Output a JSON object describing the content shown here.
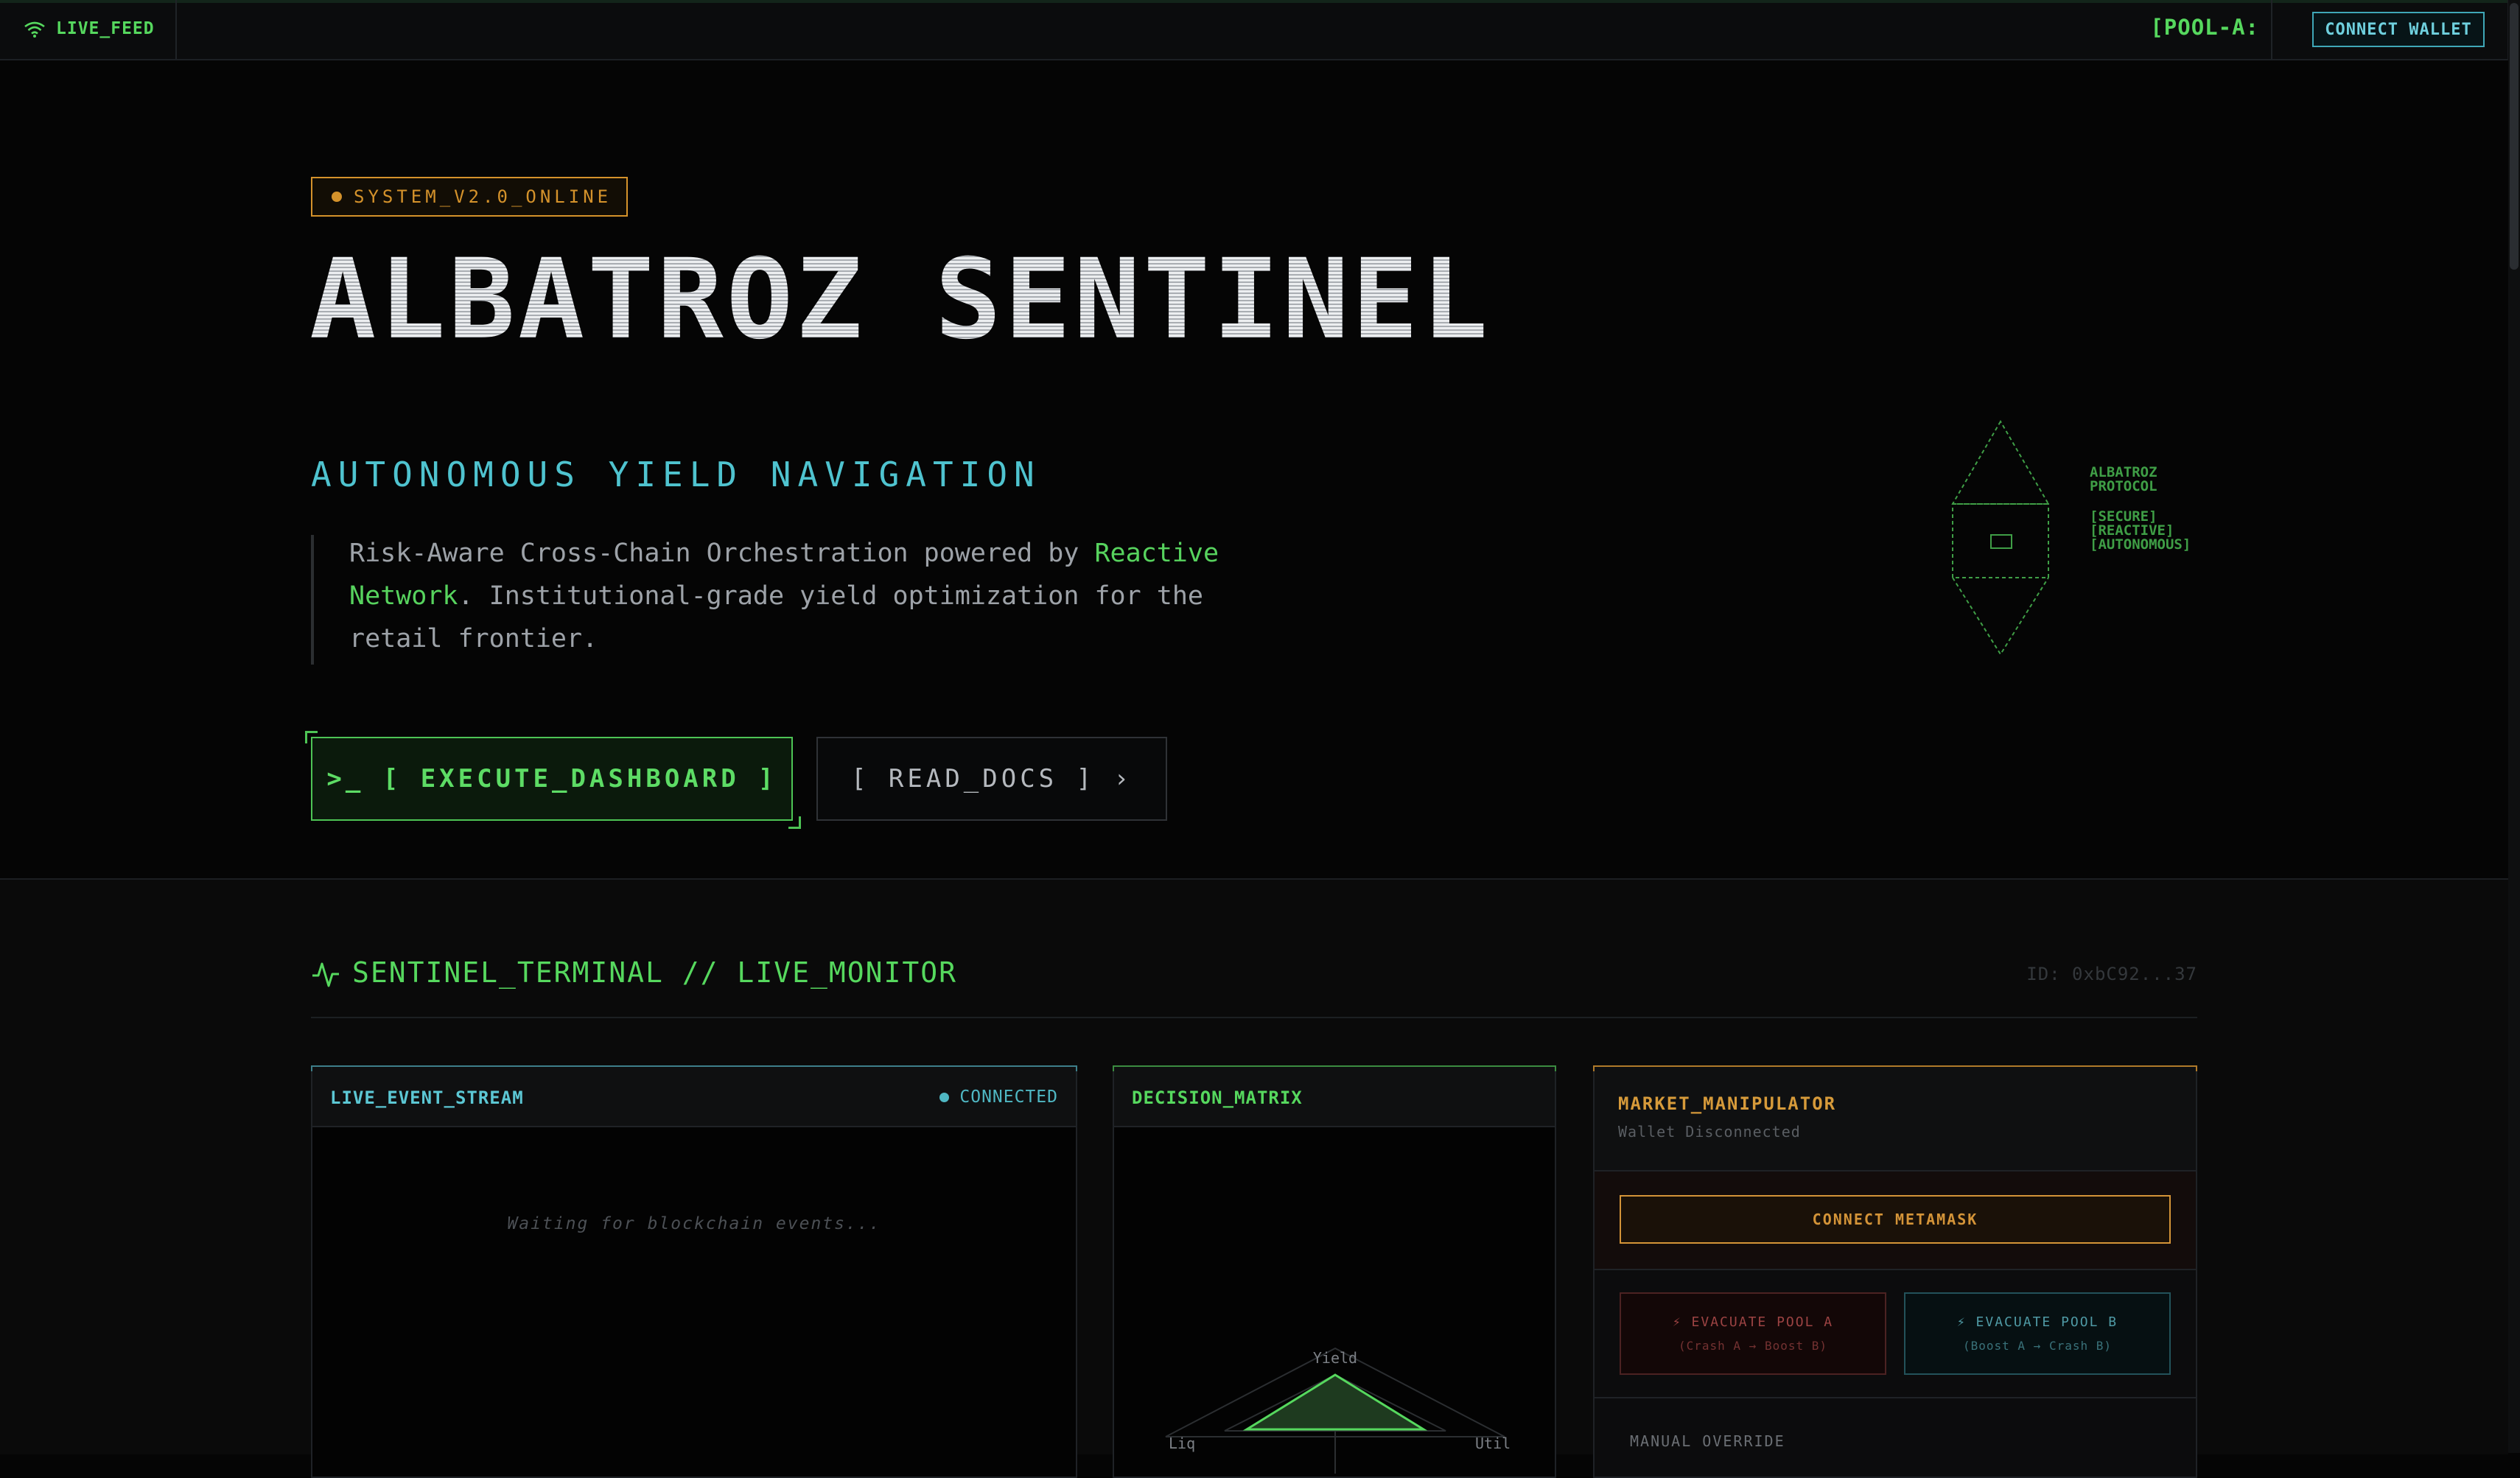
{
  "topbar": {
    "live_label": "LIVE_FEED",
    "pool_label": "[POOL-A:",
    "connect_wallet": "CONNECT WALLET"
  },
  "hero": {
    "badge": "SYSTEM_V2.0_ONLINE",
    "title": "ALBATROZ SENTINEL",
    "subtitle": "AUTONOMOUS YIELD NAVIGATION",
    "description": {
      "pre": "Risk-Aware Cross-Chain Orchestration powered by ",
      "highlight": "Reactive Network",
      "post": ". Institutional-grade yield optimization for the retail frontier."
    },
    "execute_button": ">_ [ EXECUTE_DASHBOARD ]",
    "docs_button": "[ READ_DOCS ] ›",
    "protocol_art": {
      "label_line1": "ALBATROZ",
      "label_line2": "PROTOCOL",
      "tag1": "[SECURE]",
      "tag2": "[REACTIVE]",
      "tag3": "[AUTONOMOUS]"
    }
  },
  "terminal": {
    "title": "SENTINEL_TERMINAL // LIVE_MONITOR",
    "id": "ID: 0xbC92...37",
    "event_stream": {
      "label": "LIVE_EVENT_STREAM",
      "status": "CONNECTED",
      "placeholder": "Waiting for blockchain events..."
    },
    "decision_matrix": {
      "label": "DECISION_MATRIX",
      "axes": [
        "Yield",
        "Util",
        "Liq"
      ]
    },
    "market": {
      "label": "MARKET_MANIPULATOR",
      "wallet_status": "Wallet Disconnected",
      "connect_metamask": "CONNECT METAMASK",
      "evac_a": "⚡ EVACUATE POOL A",
      "evac_a_sub": "(Crash A → Boost B)",
      "evac_b": "⚡ EVACUATE POOL B",
      "evac_b_sub": "(Boost A → Crash B)",
      "manual": "MANUAL OVERRIDE"
    }
  },
  "colors": {
    "green": "#56d85e",
    "cyan": "#4fc3cf",
    "amber": "#d4922b",
    "background": "#050505"
  }
}
